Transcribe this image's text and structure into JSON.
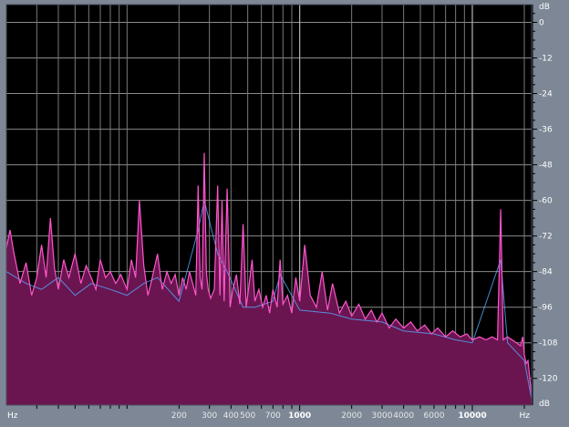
{
  "chart_data": {
    "type": "area",
    "title": "",
    "xlabel": "Hz",
    "ylabel": "dB",
    "x_scale": "log",
    "xlim": [
      20,
      22050
    ],
    "ylim": [
      -129,
      6
    ],
    "grid": true,
    "x_major_ticks": [
      {
        "value": 1000,
        "label": "1000"
      },
      {
        "value": 10000,
        "label": "10000"
      }
    ],
    "x_minor_ticks": [
      {
        "value": 200,
        "label": "200"
      },
      {
        "value": 300,
        "label": "300"
      },
      {
        "value": 400,
        "label": "400"
      },
      {
        "value": 500,
        "label": "500"
      },
      {
        "value": 700,
        "label": "700"
      },
      {
        "value": 2000,
        "label": "2000"
      },
      {
        "value": 3000,
        "label": "3000"
      },
      {
        "value": 4000,
        "label": "4000"
      },
      {
        "value": 6000,
        "label": "6000"
      }
    ],
    "x_unlabeled_gridlines": [
      30,
      40,
      50,
      60,
      70,
      80,
      90,
      100,
      600,
      800,
      900,
      5000,
      7000,
      8000,
      9000,
      20000
    ],
    "y_ticks": [
      0,
      -12,
      -24,
      -36,
      -48,
      -60,
      -72,
      -84,
      -96,
      -108,
      -120
    ],
    "series": [
      {
        "color": "#ff55cc",
        "fill": "#6a1550",
        "points": [
          [
            20,
            -76
          ],
          [
            21,
            -70
          ],
          [
            22,
            -77
          ],
          [
            24,
            -88
          ],
          [
            26,
            -81
          ],
          [
            28,
            -92
          ],
          [
            30,
            -86
          ],
          [
            32,
            -75
          ],
          [
            34,
            -86
          ],
          [
            36,
            -66
          ],
          [
            38,
            -83
          ],
          [
            40,
            -90
          ],
          [
            43,
            -80
          ],
          [
            46,
            -86
          ],
          [
            50,
            -78
          ],
          [
            54,
            -88
          ],
          [
            58,
            -82
          ],
          [
            62,
            -86
          ],
          [
            66,
            -90
          ],
          [
            70,
            -80
          ],
          [
            75,
            -86
          ],
          [
            80,
            -84
          ],
          [
            86,
            -88
          ],
          [
            92,
            -85
          ],
          [
            100,
            -90
          ],
          [
            106,
            -80
          ],
          [
            112,
            -86
          ],
          [
            118,
            -60
          ],
          [
            125,
            -82
          ],
          [
            132,
            -92
          ],
          [
            140,
            -86
          ],
          [
            150,
            -78
          ],
          [
            160,
            -90
          ],
          [
            170,
            -84
          ],
          [
            180,
            -88
          ],
          [
            190,
            -85
          ],
          [
            200,
            -92
          ],
          [
            210,
            -86
          ],
          [
            220,
            -90
          ],
          [
            230,
            -84
          ],
          [
            240,
            -88
          ],
          [
            250,
            -92
          ],
          [
            258,
            -55
          ],
          [
            265,
            -86
          ],
          [
            272,
            -90
          ],
          [
            280,
            -44
          ],
          [
            288,
            -84
          ],
          [
            295,
            -90
          ],
          [
            305,
            -93
          ],
          [
            320,
            -90
          ],
          [
            335,
            -55
          ],
          [
            345,
            -92
          ],
          [
            355,
            -60
          ],
          [
            365,
            -94
          ],
          [
            380,
            -56
          ],
          [
            395,
            -96
          ],
          [
            410,
            -90
          ],
          [
            430,
            -85
          ],
          [
            450,
            -95
          ],
          [
            470,
            -68
          ],
          [
            490,
            -96
          ],
          [
            510,
            -88
          ],
          [
            530,
            -80
          ],
          [
            550,
            -94
          ],
          [
            580,
            -90
          ],
          [
            610,
            -96
          ],
          [
            640,
            -92
          ],
          [
            670,
            -98
          ],
          [
            700,
            -90
          ],
          [
            740,
            -96
          ],
          [
            770,
            -80
          ],
          [
            800,
            -95
          ],
          [
            850,
            -92
          ],
          [
            900,
            -98
          ],
          [
            950,
            -86
          ],
          [
            1000,
            -94
          ],
          [
            1070,
            -75
          ],
          [
            1150,
            -92
          ],
          [
            1250,
            -96
          ],
          [
            1350,
            -84
          ],
          [
            1450,
            -97
          ],
          [
            1550,
            -88
          ],
          [
            1700,
            -98
          ],
          [
            1850,
            -94
          ],
          [
            2000,
            -99
          ],
          [
            2200,
            -95
          ],
          [
            2400,
            -100
          ],
          [
            2600,
            -97
          ],
          [
            2800,
            -101
          ],
          [
            3000,
            -98
          ],
          [
            3300,
            -103
          ],
          [
            3600,
            -100
          ],
          [
            4000,
            -103
          ],
          [
            4400,
            -101
          ],
          [
            4800,
            -104
          ],
          [
            5300,
            -102
          ],
          [
            5800,
            -105
          ],
          [
            6300,
            -103
          ],
          [
            7000,
            -106
          ],
          [
            7700,
            -104
          ],
          [
            8500,
            -106
          ],
          [
            9300,
            -105
          ],
          [
            10000,
            -107
          ],
          [
            11000,
            -106
          ],
          [
            12000,
            -107
          ],
          [
            13000,
            -106
          ],
          [
            14000,
            -107
          ],
          [
            14600,
            -63
          ],
          [
            15100,
            -107
          ],
          [
            16000,
            -106
          ],
          [
            17000,
            -107
          ],
          [
            18000,
            -108
          ],
          [
            19000,
            -109
          ],
          [
            19600,
            -106
          ],
          [
            20000,
            -112
          ],
          [
            20500,
            -115
          ],
          [
            21000,
            -114
          ],
          [
            22050,
            -126
          ]
        ]
      },
      {
        "color": "#55aaff",
        "points": [
          [
            20,
            -84
          ],
          [
            26,
            -88
          ],
          [
            32,
            -90
          ],
          [
            40,
            -86
          ],
          [
            50,
            -92
          ],
          [
            62,
            -88
          ],
          [
            80,
            -90
          ],
          [
            100,
            -92
          ],
          [
            125,
            -88
          ],
          [
            150,
            -86
          ],
          [
            200,
            -94
          ],
          [
            258,
            -70
          ],
          [
            280,
            -60
          ],
          [
            335,
            -78
          ],
          [
            380,
            -84
          ],
          [
            470,
            -96
          ],
          [
            550,
            -96
          ],
          [
            700,
            -94
          ],
          [
            770,
            -85
          ],
          [
            1000,
            -97
          ],
          [
            1500,
            -98
          ],
          [
            2000,
            -100
          ],
          [
            3000,
            -101
          ],
          [
            4000,
            -104
          ],
          [
            6000,
            -105
          ],
          [
            8000,
            -107
          ],
          [
            10000,
            -108
          ],
          [
            14600,
            -80
          ],
          [
            16000,
            -108
          ],
          [
            20000,
            -114
          ],
          [
            22050,
            -127
          ]
        ]
      }
    ]
  }
}
